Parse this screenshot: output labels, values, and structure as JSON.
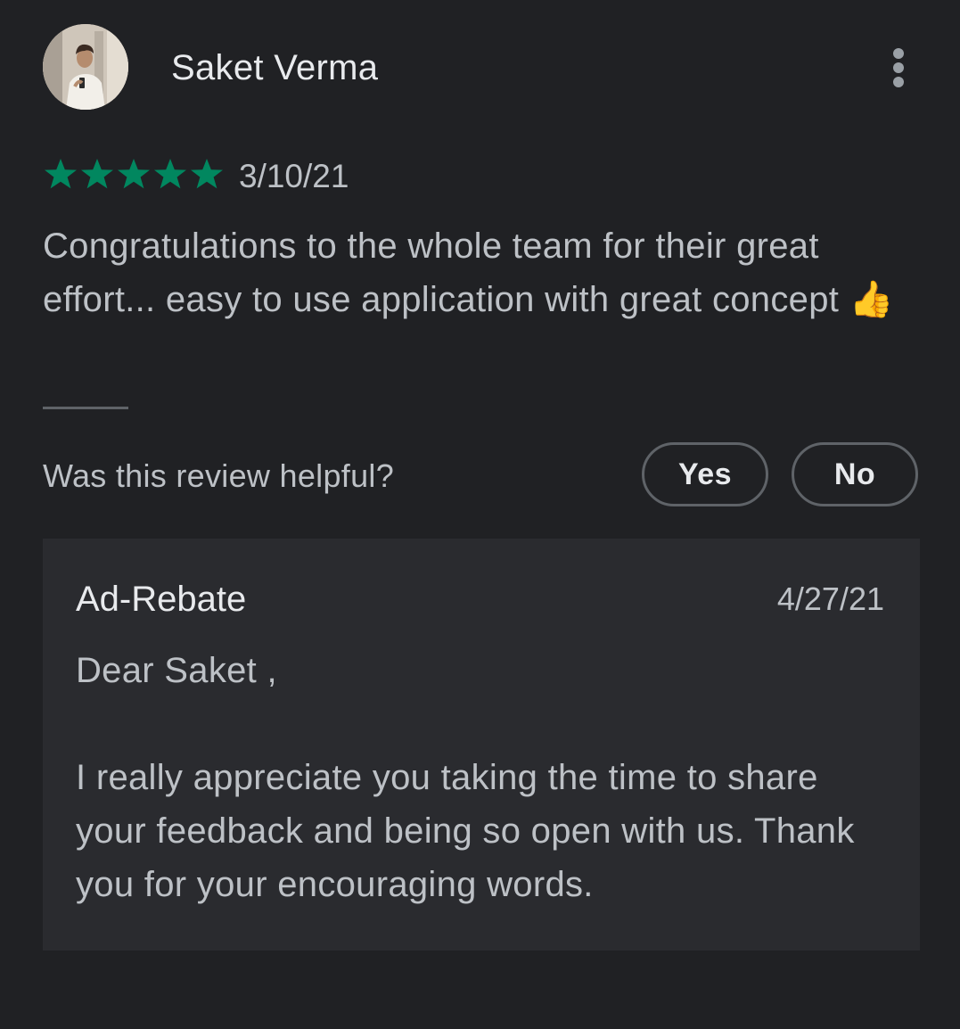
{
  "review": {
    "author": "Saket Verma",
    "avatar_icon": "user-photo-avatar",
    "menu_icon": "more-vert-icon",
    "rating": 5,
    "rating_max": 5,
    "star_color": "#01875f",
    "date": "3/10/21",
    "text": "Congratulations to the whole team for their great effort... easy to use application with great concept 👍"
  },
  "helpful": {
    "question": "Was this review helpful?",
    "yes_label": "Yes",
    "no_label": "No"
  },
  "reply": {
    "author": "Ad-Rebate",
    "date": "4/27/21",
    "greeting": "Dear Saket ,",
    "body": "I really appreciate you taking the time to share your feedback and being so open with us. Thank you for your encouraging words."
  }
}
